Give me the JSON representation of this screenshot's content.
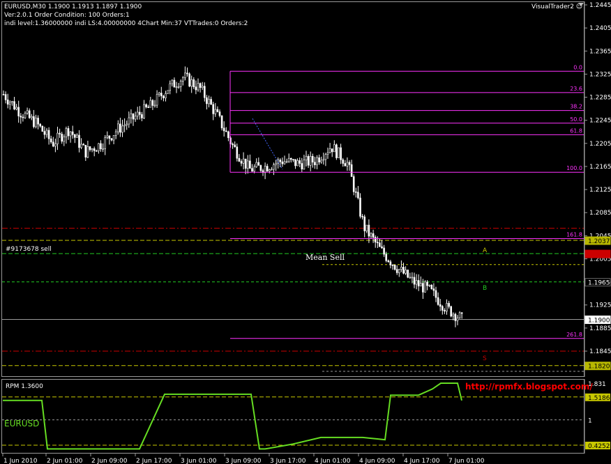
{
  "header": {
    "symbol_line": "EURUSD,M30  1.1900 1.1913 1.1897 1.1900",
    "version_line": "Ver:2.0.1 Order Condition: 100 Orders:1",
    "indi_line": "indi level:1.36000000 indi LS:4.00000000 4Chart Min:37 VTTrades:0 Orders:2",
    "brand": "VisualTrader2 ☺"
  },
  "colors": {
    "fib": "#ff33ff",
    "candle": "#ffffff",
    "green": "#22cc22",
    "yellow": "#c8c800",
    "red": "#cc0000",
    "indicator": "#66dd22",
    "url": "#ff0000"
  },
  "chart_data": {
    "type": "candlestick",
    "symbol": "EURUSD",
    "timeframe": "M30",
    "price_axis": [
      "1.2445",
      "1.2405",
      "1.2365",
      "1.2325",
      "1.2285",
      "1.2245",
      "1.2205",
      "1.2165",
      "1.2125",
      "1.2085",
      "1.2045",
      "1.2005",
      "1.1965",
      "1.1925",
      "1.1885",
      "1.1845"
    ],
    "time_axis": [
      "1 Jun 2010",
      "2 Jun 01:00",
      "2 Jun 09:00",
      "2 Jun 17:00",
      "3 Jun 01:00",
      "3 Jun 09:00",
      "3 Jun 17:00",
      "4 Jun 01:00",
      "4 Jun 09:00",
      "4 Jun 17:00",
      "7 Jun 01:00"
    ],
    "close_path": [
      1.229,
      1.226,
      1.224,
      1.2205,
      1.223,
      1.219,
      1.2205,
      1.223,
      1.225,
      1.227,
      1.23,
      1.232,
      1.23,
      1.2255,
      1.22,
      1.216,
      1.2165,
      1.2175,
      1.217,
      1.2175,
      1.22,
      1.217,
      1.206,
      1.202,
      1.199,
      1.1965,
      1.195,
      1.192,
      1.19
    ],
    "fib_levels": [
      {
        "label": "0.0",
        "price": 1.233
      },
      {
        "label": "23.6",
        "price": 1.2293
      },
      {
        "label": "38.2",
        "price": 1.2262
      },
      {
        "label": "50.0",
        "price": 1.224
      },
      {
        "label": "61.8",
        "price": 1.222
      },
      {
        "label": "100.0",
        "price": 1.2155
      },
      {
        "label": "161.8",
        "price": 1.204
      },
      {
        "label": "261.8",
        "price": 1.1867
      }
    ],
    "price_tags": [
      {
        "label": "1.2037",
        "price": 1.2037,
        "bg": "#b8b800",
        "fg": "#000000"
      },
      {
        "label": "1.2014",
        "price": 1.2014,
        "bg": "#cc0000",
        "fg": "#cc0000"
      },
      {
        "label": "1.1965",
        "price": 1.1965,
        "bg": "#000000",
        "fg": "#ffffff"
      },
      {
        "label": "1.1900",
        "price": 1.19,
        "bg": "#ffffff",
        "fg": "#000000"
      },
      {
        "label": "1.1820",
        "price": 1.182,
        "bg": "#b8b800",
        "fg": "#000000"
      }
    ],
    "zone_letters": [
      {
        "label": "A",
        "price": 1.202
      },
      {
        "label": "B",
        "price": 1.1955
      },
      {
        "label": "S",
        "price": 1.1833
      }
    ],
    "order_label": "#9173678 sell",
    "mean_label": "Mean Sell"
  },
  "indicator": {
    "title": "RPM 1.3600",
    "symbol_label": "EURUSD",
    "url": "http://rpmfx.blogspot.com/",
    "axis": [
      "1.831",
      "1.5186",
      "1",
      "0.4252"
    ],
    "values": [
      1.44,
      1.44,
      0.34,
      0.34,
      0.34,
      1.58,
      1.58,
      1.58,
      1.58,
      0.34,
      0.34,
      0.45,
      0.6,
      0.6,
      0.55,
      1.56,
      1.56,
      1.7,
      1.831,
      1.831,
      1.44
    ]
  }
}
